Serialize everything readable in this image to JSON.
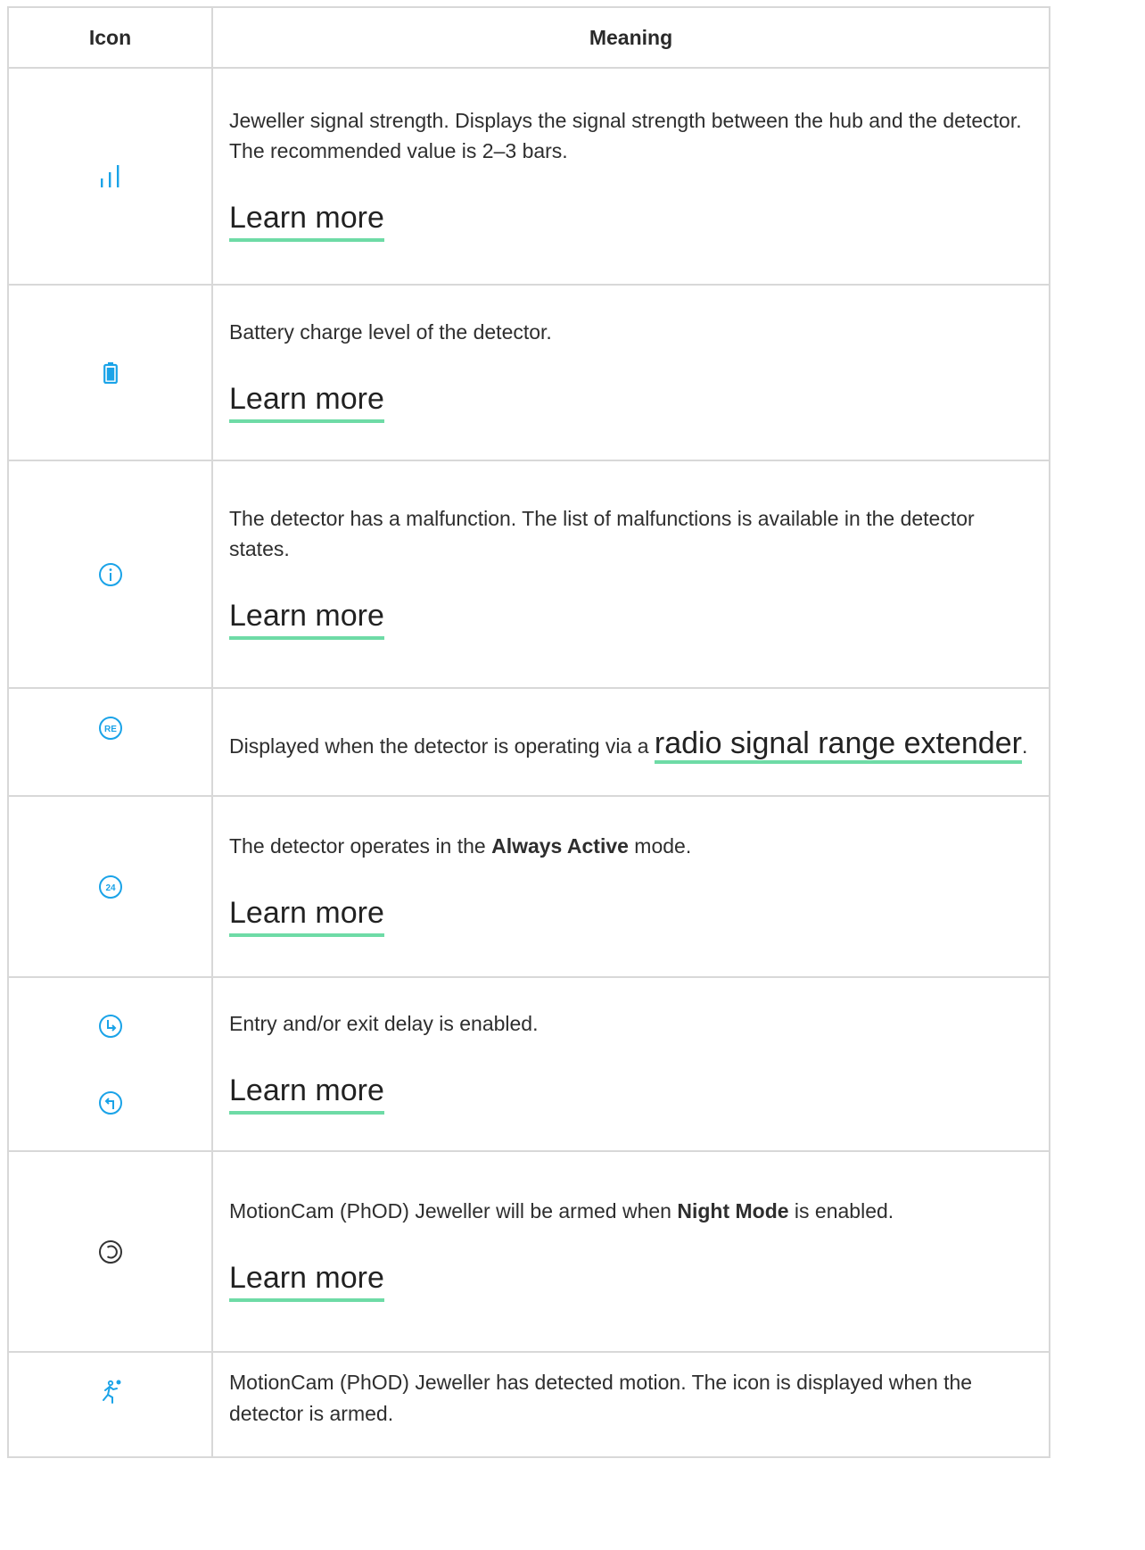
{
  "table": {
    "headers": {
      "icon": "Icon",
      "meaning": "Meaning"
    },
    "rows": [
      {
        "icon": "signal-strength-icon",
        "text": "Jeweller signal strength. Displays the signal strength between the hub and the detector. The recommended value is 2–3 bars.",
        "link": "Learn more"
      },
      {
        "icon": "battery-icon",
        "text": "Battery charge level of the detector.",
        "link": "Learn more"
      },
      {
        "icon": "info-icon",
        "text": "The detector has a malfunction. The list of malfunctions is available in the detector states.",
        "link": "Learn more"
      },
      {
        "icon": "range-extender-icon",
        "icon_label": "RE",
        "text_before": "Displayed when the detector is operating via a ",
        "inline_link": "radio signal range extender",
        "text_after": "."
      },
      {
        "icon": "always-active-icon",
        "icon_label": "24",
        "text_before": "The detector operates in the ",
        "bold": "Always Active",
        "text_after": " mode.",
        "link": "Learn more"
      },
      {
        "icon": "entry-exit-delay-icons",
        "text": "Entry and/or exit delay is enabled.",
        "link": "Learn more"
      },
      {
        "icon": "night-mode-icon",
        "text_before": "MotionCam (PhOD) Jeweller will be armed when ",
        "bold": "Night Mode",
        "text_after": " is enabled.",
        "link": "Learn more"
      },
      {
        "icon": "motion-detected-icon",
        "text": "MotionCam (PhOD) Jeweller has detected motion. The icon is displayed when the detector is armed."
      }
    ]
  },
  "colors": {
    "icon_blue": "#1aa3e8",
    "underline_green": "#6edba6",
    "border": "#d8d8d8"
  }
}
